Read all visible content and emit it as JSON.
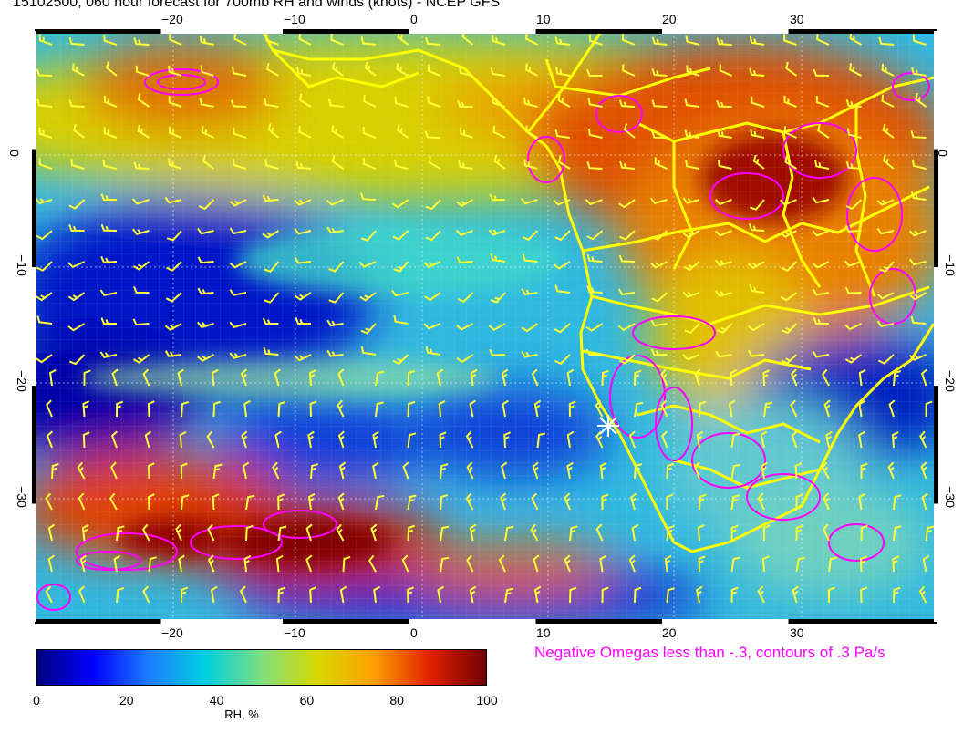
{
  "title": "15102500, 060 hour forecast for 700mb RH and winds (knots) - NCEP GFS",
  "map": {
    "top_lon_labels": [
      "−20",
      "−10",
      "0",
      "10",
      "20",
      "30"
    ],
    "bottom_lon_labels": [
      "−20",
      "−10",
      "0",
      "10",
      "20",
      "30"
    ],
    "left_lat_labels": [
      "0",
      "−10",
      "−20",
      "−30"
    ],
    "right_lat_labels": [
      "0",
      "−10",
      "−20",
      "−30"
    ],
    "barb_color": "#ffff33",
    "coast_color": "#ffff00",
    "omega_color": "#ff00ff",
    "marker_color": "#ffffff",
    "marker_icon": "star-marker-icon"
  },
  "colorbar": {
    "label": "RH, %",
    "ticks": [
      "0",
      "20",
      "40",
      "60",
      "80",
      "100"
    ],
    "colors": [
      "#000080",
      "#0000ff",
      "#1f7fff",
      "#00d0e0",
      "#7fdf7f",
      "#d8d800",
      "#ff9f00",
      "#e02000",
      "#700000"
    ]
  },
  "omega_note": "Negative Omegas less than -.3, contours of .3 Pa/s"
}
